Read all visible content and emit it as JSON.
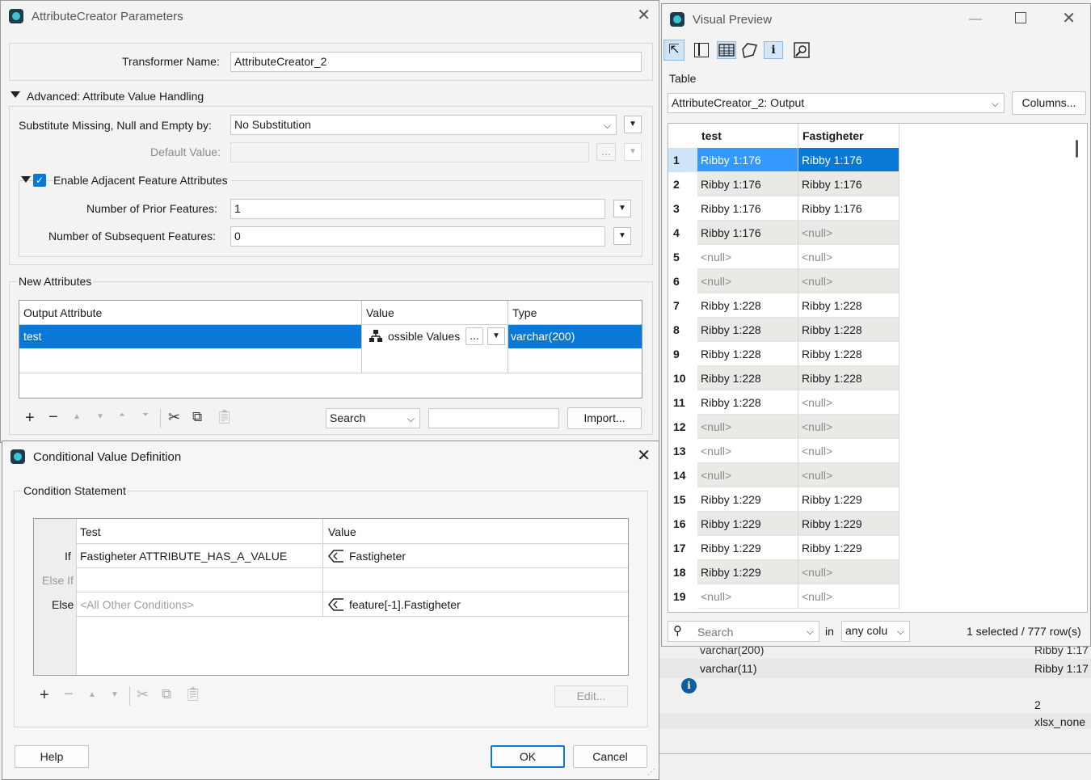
{
  "attr_dialog": {
    "title": "AttributeCreator Parameters",
    "transformer_name_label": "Transformer Name:",
    "transformer_name_value": "AttributeCreator_2",
    "advanced_label": "Advanced: Attribute Value Handling",
    "substitute_label": "Substitute Missing, Null and Empty by:",
    "substitute_value": "No Substitution",
    "default_value_label": "Default Value:",
    "default_value_btn": "...",
    "enable_adjacent_label": "Enable Adjacent Feature Attributes",
    "prior_label": "Number of Prior Features:",
    "prior_value": "1",
    "subsequent_label": "Number of Subsequent Features:",
    "subsequent_value": "0",
    "new_attributes_label": "New Attributes",
    "columns": [
      "Output Attribute",
      "Value",
      "Type"
    ],
    "row": {
      "output": "test",
      "value": "ossible Values",
      "value_btn": "...",
      "type": "varchar(200)"
    },
    "search_select": "Search",
    "import_label": "Import..."
  },
  "cond_dialog": {
    "title": "Conditional Value Definition",
    "section_label": "Condition Statement",
    "col_test": "Test",
    "col_value": "Value",
    "rows": [
      {
        "label": "If",
        "test": "Fastigheter ATTRIBUTE_HAS_A_VALUE",
        "value": "Fastigheter"
      },
      {
        "label": "Else If",
        "test": "",
        "value": ""
      },
      {
        "label": "Else",
        "test": "<All Other Conditions>",
        "value": "feature[-1].Fastigheter"
      }
    ],
    "edit_label": "Edit...",
    "help_label": "Help",
    "ok_label": "OK",
    "cancel_label": "Cancel"
  },
  "preview": {
    "title": "Visual Preview",
    "table_label": "Table",
    "table_select": "AttributeCreator_2: Output",
    "columns_btn": "Columns...",
    "headers": [
      "test",
      "Fastigheter"
    ],
    "rows": [
      [
        "1",
        "Ribby 1:176",
        "Ribby 1:176"
      ],
      [
        "2",
        "Ribby 1:176",
        "Ribby 1:176"
      ],
      [
        "3",
        "Ribby 1:176",
        "Ribby 1:176"
      ],
      [
        "4",
        "Ribby 1:176",
        "<null>"
      ],
      [
        "5",
        "<null>",
        "<null>"
      ],
      [
        "6",
        "<null>",
        "<null>"
      ],
      [
        "7",
        "Ribby 1:228",
        "Ribby 1:228"
      ],
      [
        "8",
        "Ribby 1:228",
        "Ribby 1:228"
      ],
      [
        "9",
        "Ribby 1:228",
        "Ribby 1:228"
      ],
      [
        "10",
        "Ribby 1:228",
        "Ribby 1:228"
      ],
      [
        "11",
        "Ribby 1:228",
        "<null>"
      ],
      [
        "12",
        "<null>",
        "<null>"
      ],
      [
        "13",
        "<null>",
        "<null>"
      ],
      [
        "14",
        "<null>",
        "<null>"
      ],
      [
        "15",
        "Ribby 1:229",
        "Ribby 1:229"
      ],
      [
        "16",
        "Ribby 1:229",
        "Ribby 1:229"
      ],
      [
        "17",
        "Ribby 1:229",
        "Ribby 1:229"
      ],
      [
        "18",
        "Ribby 1:229",
        "<null>"
      ],
      [
        "19",
        "<null>",
        "<null>"
      ]
    ],
    "search_placeholder": "Search",
    "in_label": "in",
    "in_select": "any colu",
    "status": "1 selected / 777 row(s)"
  },
  "background": {
    "type1": "varchar(200)",
    "type2": "varchar(11)",
    "val1": "Ribby 1:17",
    "val2": "Ribby 1:17",
    "num": "2",
    "fmt": "xlsx_none"
  },
  "colors": {
    "accent": "#0a78d7",
    "selected_row": "#0a78d7",
    "selected_cell": "#3399ff"
  }
}
